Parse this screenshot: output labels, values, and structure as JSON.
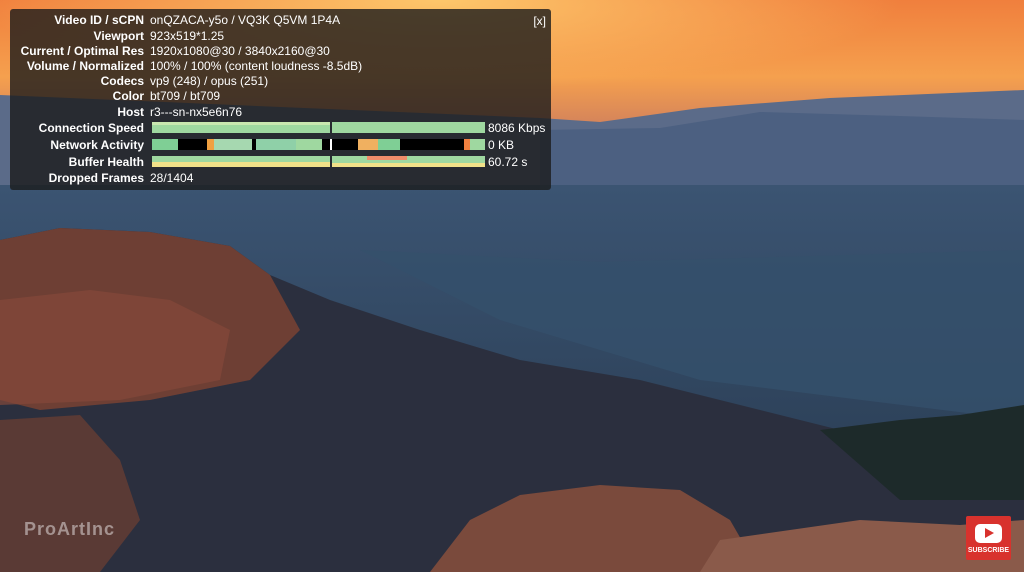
{
  "stats": {
    "close_label": "[x]",
    "rows": [
      {
        "label": "Video ID / sCPN",
        "value": "onQZACA-y5o / VQ3K Q5VM 1P4A"
      },
      {
        "label": "Viewport",
        "value": "923x519*1.25"
      },
      {
        "label": "Current / Optimal Res",
        "value": "1920x1080@30 / 3840x2160@30"
      },
      {
        "label": "Volume / Normalized",
        "value": "100% / 100% (content loudness -8.5dB)"
      },
      {
        "label": "Codecs",
        "value": "vp9 (248) / opus (251)"
      },
      {
        "label": "Color",
        "value": "bt709 / bt709"
      },
      {
        "label": "Host",
        "value": "r3---sn-nx5e6n76"
      }
    ],
    "connection_speed": {
      "label": "Connection Speed",
      "value": "8086 Kbps"
    },
    "network_activity": {
      "label": "Network Activity",
      "value": "0 KB"
    },
    "buffer_health": {
      "label": "Buffer Health",
      "value": "60.72 s"
    },
    "dropped_frames": {
      "label": "Dropped Frames",
      "value": "28/1404"
    }
  },
  "watermark": "ProArtInc",
  "subscribe_label": "SUBSCRIBE",
  "colors": {
    "graph_green": "#9fd8a0",
    "graph_yellow": "#f1e189",
    "panel_bg": "rgba(28,28,28,0.80)",
    "subscribe_red": "#d8322d"
  }
}
